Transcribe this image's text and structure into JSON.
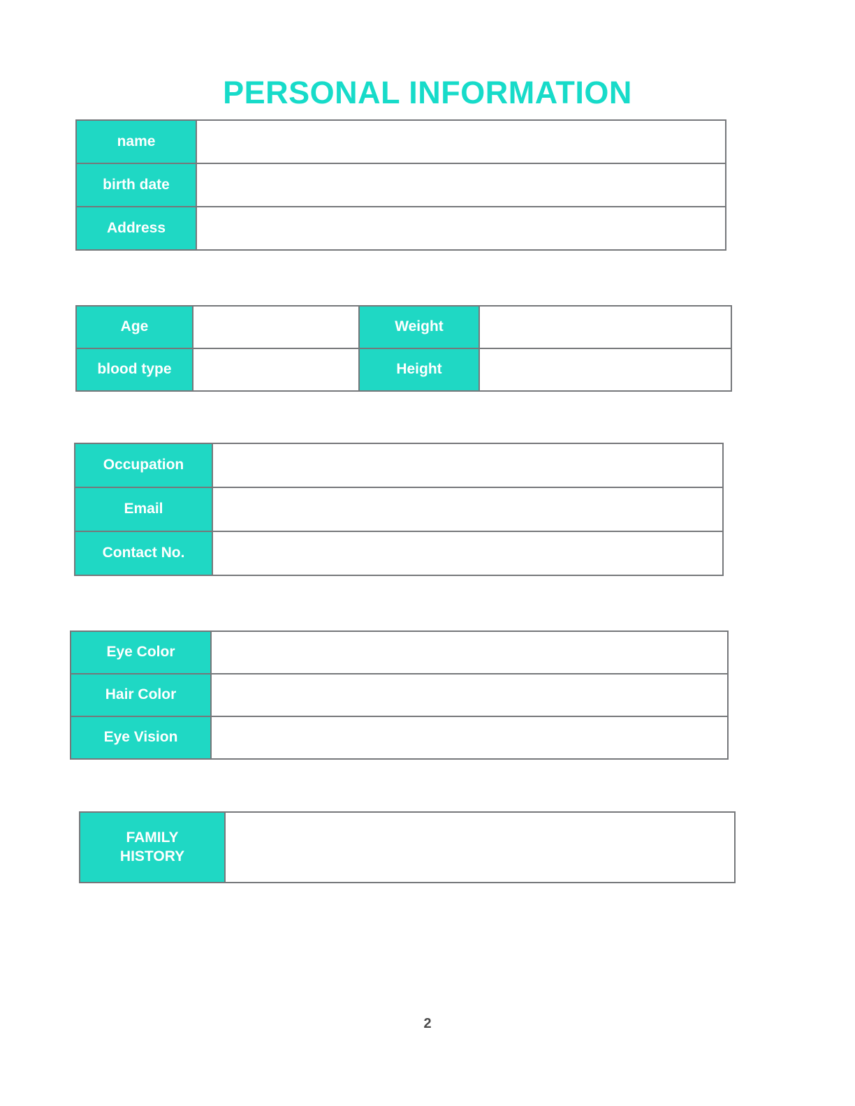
{
  "document": {
    "title": "PERSONAL INFORMATION",
    "page_number": "2",
    "accent_color": "#1fd8c4",
    "title_color": "#17dbc9",
    "border_color": "#75777a",
    "label_text_color": "#ffffff",
    "background_color": "#ffffff"
  },
  "sections": {
    "identity": {
      "rows": [
        {
          "label": "name",
          "value": ""
        },
        {
          "label": "birth date",
          "value": ""
        },
        {
          "label": "Address",
          "value": ""
        }
      ]
    },
    "body_metrics": {
      "rows": [
        {
          "label_a": "Age",
          "value_a": "",
          "label_b": "Weight",
          "value_b": ""
        },
        {
          "label_a": "blood type",
          "value_a": "",
          "label_b": "Height",
          "value_b": ""
        }
      ]
    },
    "contact": {
      "rows": [
        {
          "label": "Occupation",
          "value": ""
        },
        {
          "label": "Email",
          "value": ""
        },
        {
          "label": "Contact No.",
          "value": ""
        }
      ]
    },
    "physical": {
      "rows": [
        {
          "label": "Eye Color",
          "value": ""
        },
        {
          "label": "Hair Color",
          "value": ""
        },
        {
          "label": "Eye Vision",
          "value": ""
        }
      ]
    },
    "family": {
      "rows": [
        {
          "label_line1": "FAMILY",
          "label_line2": "HISTORY",
          "value": ""
        }
      ]
    }
  }
}
